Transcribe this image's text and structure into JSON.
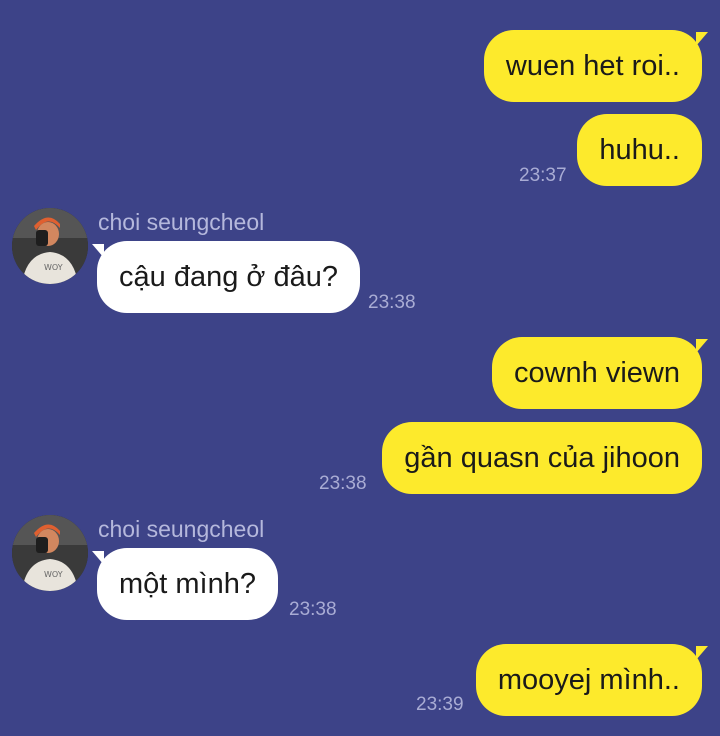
{
  "colors": {
    "background": "#3d4388",
    "outgoing_bubble": "#fdea2c",
    "incoming_bubble": "#ffffff",
    "timestamp": "#a9acd4",
    "sender_name": "#b5b8dc"
  },
  "messages": [
    {
      "direction": "out",
      "text": "wuen het roi.."
    },
    {
      "direction": "out",
      "text": "huhu..",
      "time": "23:37"
    },
    {
      "direction": "in",
      "sender": "choi seungcheol",
      "avatar_icon": "user-photo-icon",
      "text": "cậu đang ở đâu?",
      "time": "23:38"
    },
    {
      "direction": "out",
      "text": "cownh viewn"
    },
    {
      "direction": "out",
      "text": "gần quasn của jihoon",
      "time": "23:38"
    },
    {
      "direction": "in",
      "sender": "choi seungcheol",
      "avatar_icon": "user-photo-icon",
      "text": "một mình?",
      "time": "23:38"
    },
    {
      "direction": "out",
      "text": "mooyej mình..",
      "time": "23:39"
    }
  ]
}
